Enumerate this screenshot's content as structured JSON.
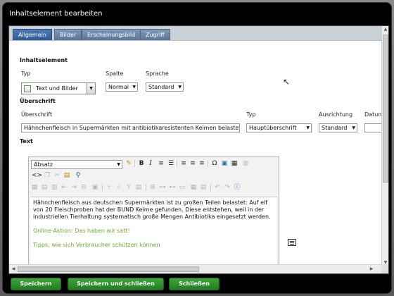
{
  "dialog": {
    "title": "Inhaltselement bearbeiten"
  },
  "tabs": [
    {
      "label": "Allgemein",
      "active": true
    },
    {
      "label": "Bilder",
      "active": false
    },
    {
      "label": "Erscheinungsbild",
      "active": false
    },
    {
      "label": "Zugriff",
      "active": false
    }
  ],
  "section_inhaltselement": {
    "heading": "Inhaltselement",
    "typ_label": "Typ",
    "typ_value": "Text und Bilder",
    "spalte_label": "Spalte",
    "spalte_value": "Normal",
    "sprache_label": "Sprache",
    "sprache_value": "Standard"
  },
  "section_ueberschrift": {
    "heading": "Überschrift",
    "ueberschrift_label": "Überschrift",
    "ueberschrift_value": "Hähnchenfleisch in Supermärkten mit antibiotikaresistenten Keimen belastet",
    "typ_label": "Typ",
    "typ_value": "Hauptüberschrift",
    "ausrichtung_label": "Ausrichtung",
    "ausrichtung_value": "Standard",
    "datum_label": "Datum"
  },
  "section_text": {
    "heading": "Text",
    "format_value": "Absatz",
    "paragraph_1": "Hähnchenfleisch aus deutschen Supermärkten ist zu großen Teilen belastet: Auf elf von 20 Fleischproben hat der BUND Keime gefunden. Diese entstehen, weil in der industriellen Tierhaltung systematisch große Mengen Antibiotika eingesetzt werden.",
    "link_1": "Online-Aktion: Das haben wir satt!",
    "link_2": "Tipps, wie sich Verbraucher schützen können"
  },
  "buttons": {
    "save": "Speichern",
    "save_close": "Speichern und schließen",
    "close": "Schließen"
  },
  "colors": {
    "button_green": "#2e8f2c",
    "tab_active": "#3d6aa6",
    "link_green": "#6cae2c"
  }
}
